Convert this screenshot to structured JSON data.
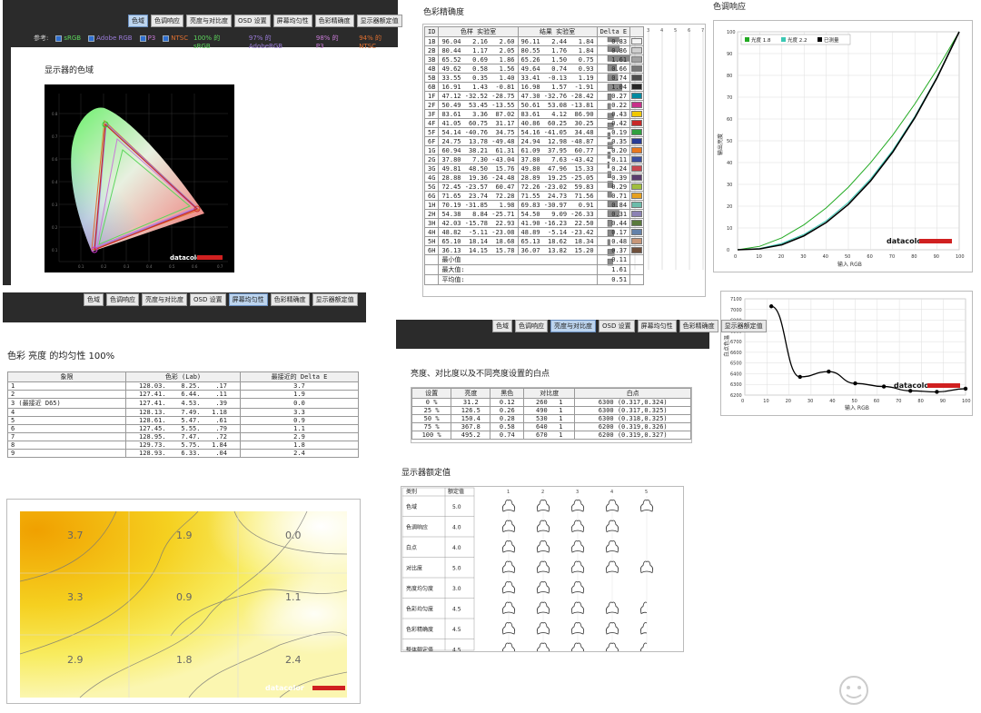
{
  "tabs": [
    "色域",
    "色调响应",
    "亮度与对比度",
    "OSD 设置",
    "屏幕均匀性",
    "色彩精确度",
    "显示器额定值"
  ],
  "gamut": {
    "ref_label": "参考:",
    "refs": [
      {
        "name": "sRGB",
        "color": "#5cd65c"
      },
      {
        "name": "Adobe RGB",
        "color": "#9a7bd8"
      },
      {
        "name": "P3",
        "color": "#c97bd8"
      },
      {
        "name": "NTSC",
        "color": "#e07030"
      }
    ],
    "coverage": [
      {
        "text": "100% 的 sRGB",
        "color": "#5cd65c"
      },
      {
        "text": "97% 的 AdobeRGB",
        "color": "#9a7bd8"
      },
      {
        "text": "98% 的 P3",
        "color": "#c97bd8"
      },
      {
        "text": "94% 的 NTSC",
        "color": "#e07030"
      }
    ],
    "title": "显示器的色域",
    "brand": "datacolor"
  },
  "accuracy": {
    "title": "色彩精确度",
    "headers": [
      "ID",
      "色样",
      "实验室",
      "结果",
      "实验室",
      "Delta E"
    ],
    "scale": [
      "1",
      "2",
      "3",
      "4",
      "5",
      "6",
      "7"
    ],
    "rows": [
      {
        "id": "1B",
        "a": "96.04   2.16   2.60",
        "b": "96.11   2.44   1.84",
        "d": 0.83,
        "c": "#f4f4f4"
      },
      {
        "id": "2B",
        "a": "80.44   1.17   2.05",
        "b": "80.55   1.76   1.84",
        "d": 0.86,
        "c": "#cfcfcf"
      },
      {
        "id": "3B",
        "a": "65.52   0.69   1.86",
        "b": "65.26   1.50   0.75",
        "d": 1.61,
        "c": "#a2a2a2"
      },
      {
        "id": "4B",
        "a": "49.62   0.58   1.56",
        "b": "49.64   0.74   0.93",
        "d": 0.66,
        "c": "#777"
      },
      {
        "id": "5B",
        "a": "33.55   0.35   1.40",
        "b": "33.41  -0.13   1.19",
        "d": 0.74,
        "c": "#4c4c4c"
      },
      {
        "id": "6B",
        "a": "16.91   1.43  -0.81",
        "b": "16.98   1.57  -1.91",
        "d": 1.04,
        "c": "#262626"
      },
      {
        "id": "1F",
        "a": "47.12 -32.52 -28.75",
        "b": "47.30 -32.76 -28.42",
        "d": 0.27,
        "c": "#008aa0"
      },
      {
        "id": "2F",
        "a": "50.49  53.45 -13.55",
        "b": "50.61  53.08 -13.81",
        "d": 0.22,
        "c": "#c8308a"
      },
      {
        "id": "3F",
        "a": "83.61   3.36  87.02",
        "b": "83.61   4.12  86.90",
        "d": 0.43,
        "c": "#f0c800"
      },
      {
        "id": "4F",
        "a": "41.05  60.75  31.17",
        "b": "40.86  60.25  30.25",
        "d": 0.42,
        "c": "#c82828"
      },
      {
        "id": "5F",
        "a": "54.14 -40.76  34.75",
        "b": "54.16 -41.05  34.48",
        "d": 0.19,
        "c": "#30a040"
      },
      {
        "id": "6F",
        "a": "24.75  13.78 -49.48",
        "b": "24.94  12.98 -48.87",
        "d": 0.35,
        "c": "#283c96"
      },
      {
        "id": "1G",
        "a": "60.94  38.21  61.31",
        "b": "61.09  37.95  60.77",
        "d": 0.2,
        "c": "#e8781e"
      },
      {
        "id": "2G",
        "a": "37.80   7.30 -43.04",
        "b": "37.80   7.63 -43.42",
        "d": 0.11,
        "c": "#3c50a0"
      },
      {
        "id": "3G",
        "a": "49.81  48.50  15.76",
        "b": "49.80  47.96  15.33",
        "d": 0.24,
        "c": "#c84650"
      },
      {
        "id": "4G",
        "a": "28.88  19.36 -24.48",
        "b": "28.89  19.25 -25.05",
        "d": 0.39,
        "c": "#5a3c6e"
      },
      {
        "id": "5G",
        "a": "72.45 -23.57  60.47",
        "b": "72.26 -23.02  59.83",
        "d": 0.29,
        "c": "#a0be3c"
      },
      {
        "id": "6G",
        "a": "71.65  23.74  72.28",
        "b": "71.55  24.73  71.56",
        "d": 0.71,
        "c": "#e6a01e"
      },
      {
        "id": "1H",
        "a": "70.19 -31.85   1.98",
        "b": "69.83 -30.97   0.91",
        "d": 0.84,
        "c": "#6cbcaa"
      },
      {
        "id": "2H",
        "a": "54.38   8.84 -25.71",
        "b": "54.50   9.09 -26.33",
        "d": 0.31,
        "c": "#8c82b4"
      },
      {
        "id": "3H",
        "a": "42.03 -15.78  22.93",
        "b": "41.90 -16.23  22.50",
        "d": 0.44,
        "c": "#5a7a3c"
      },
      {
        "id": "4H",
        "a": "48.82  -5.11 -23.08",
        "b": "48.89  -5.14 -23.42",
        "d": 0.17,
        "c": "#6482aa"
      },
      {
        "id": "5H",
        "a": "65.10  18.14  18.68",
        "b": "65.13  18.62  18.34",
        "d": 0.48,
        "c": "#c89678"
      },
      {
        "id": "6H",
        "a": "36.13  14.15  15.78",
        "b": "36.07  13.82  15.20",
        "d": 0.37,
        "c": "#70503c"
      }
    ],
    "summary": [
      {
        "label": "最小值",
        "val": "0.11"
      },
      {
        "label": "最大值:",
        "val": "1.61"
      },
      {
        "label": "平均值:",
        "val": "0.51"
      }
    ]
  },
  "tone": {
    "title": "色调响应",
    "legend": [
      "光度 1.8",
      "光度 2.2",
      "已测量"
    ],
    "xlabel": "输入 RGB",
    "ylabel": "输出亮度",
    "brand": "datacolor"
  },
  "whitepoint": {
    "xlabel": "输入 RGB",
    "ylabel": "白点色温",
    "brand": "datacolor"
  },
  "uniformity": {
    "title": "色彩 亮度 的均匀性 100%",
    "headers": [
      "象限",
      "色彩 (Lab)",
      "最接近的 Delta E"
    ],
    "rows": [
      {
        "q": "1",
        "lab": "128.03.    8.25.    .17",
        "de": "3.7"
      },
      {
        "q": "2",
        "lab": "127.41.    6.44.    .11",
        "de": "1.9"
      },
      {
        "q": "3 (最接近 D65)",
        "lab": "127.41.    4.53.    .39",
        "de": "0.0"
      },
      {
        "q": "4",
        "lab": "128.13.    7.49.   1.18",
        "de": "3.3"
      },
      {
        "q": "5",
        "lab": "128.61.    5.47.    .61",
        "de": "0.9"
      },
      {
        "q": "6",
        "lab": "127.45.    5.55.    .79",
        "de": "1.1"
      },
      {
        "q": "7",
        "lab": "128.95.    7.47.    .72",
        "de": "2.9"
      },
      {
        "q": "8",
        "lab": "129.73.    5.75.   1.84",
        "de": "1.8"
      },
      {
        "q": "9",
        "lab": "128.93.    6.33.    .04",
        "de": "2.4"
      }
    ],
    "map_values": [
      "3.7",
      "1.9",
      "0.0",
      "3.3",
      "0.9",
      "1.1",
      "2.9",
      "1.8",
      "2.4"
    ],
    "brand": "datacolor"
  },
  "brightness": {
    "title": "亮度、对比度以及不同亮度设置的白点",
    "headers": [
      "设置",
      "亮度",
      "黑色",
      "对比度",
      "白点"
    ],
    "rows": [
      [
        "0 %",
        "31.2",
        "0.12",
        "260   1",
        "6300 (0.317,0.324)"
      ],
      [
        "25 %",
        "126.5",
        "0.26",
        "490   1",
        "6300 (0.317,0.325)"
      ],
      [
        "50 %",
        "150.4",
        "0.28",
        "530   1",
        "6300 (0.318,0.325)"
      ],
      [
        "75 %",
        "367.8",
        "0.58",
        "640   1",
        "6200 (0.319,0.326)"
      ],
      [
        "100 %",
        "495.2",
        "0.74",
        "670   1",
        "6200 (0.319,0.327)"
      ]
    ]
  },
  "ratings": {
    "title": "显示器额定值",
    "headers": [
      "类别",
      "额定值"
    ],
    "scale": [
      "1",
      "2",
      "3",
      "4",
      "5"
    ],
    "rows": [
      {
        "name": "色域",
        "val": 5.0,
        "label": "5.0"
      },
      {
        "name": "色调响应",
        "val": 4.0,
        "label": "4.0"
      },
      {
        "name": "白点",
        "val": 4.0,
        "label": "4.0"
      },
      {
        "name": "对比度",
        "val": 5.0,
        "label": "5.0"
      },
      {
        "name": "亮度均匀度",
        "val": 3.0,
        "label": "3.0"
      },
      {
        "name": "色彩均匀度",
        "val": 4.5,
        "label": "4.5"
      },
      {
        "name": "色彩精确度",
        "val": 4.5,
        "label": "4.5"
      },
      {
        "name": "整体额定值",
        "val": 4.5,
        "label": "4.5"
      }
    ]
  },
  "chart_data": [
    {
      "type": "line",
      "title": "色调响应",
      "xlabel": "输入 RGB",
      "ylabel": "输出亮度",
      "xlim": [
        0,
        100
      ],
      "ylim": [
        0,
        100
      ],
      "x": [
        0,
        10,
        20,
        30,
        40,
        50,
        60,
        70,
        80,
        90,
        100
      ],
      "series": [
        {
          "name": "光度 1.8",
          "color": "#22aa22",
          "values": [
            0,
            1.6,
            5.5,
            11.5,
            19.2,
            28.7,
            39.9,
            52.6,
            66.9,
            82.7,
            100
          ]
        },
        {
          "name": "光度 2.2",
          "color": "#3cc8b4",
          "values": [
            0,
            0.6,
            2.9,
            7.1,
            13.3,
            21.8,
            32.5,
            45.6,
            61.2,
            79.3,
            100
          ]
        },
        {
          "name": "已测量",
          "color": "#000000",
          "values": [
            0,
            0.4,
            2.3,
            6.4,
            12.5,
            20.8,
            31.6,
            44.8,
            60.6,
            78.9,
            100
          ]
        }
      ]
    },
    {
      "type": "line",
      "xlabel": "输入 RGB",
      "ylabel": "白点色温",
      "xlim": [
        0,
        100
      ],
      "ylim": [
        6200,
        7100
      ],
      "x": [
        12,
        25,
        38,
        50,
        63,
        75,
        87,
        100
      ],
      "series": [
        {
          "values": [
            7030,
            6370,
            6420,
            6310,
            6280,
            6240,
            6230,
            6260
          ]
        }
      ]
    }
  ]
}
